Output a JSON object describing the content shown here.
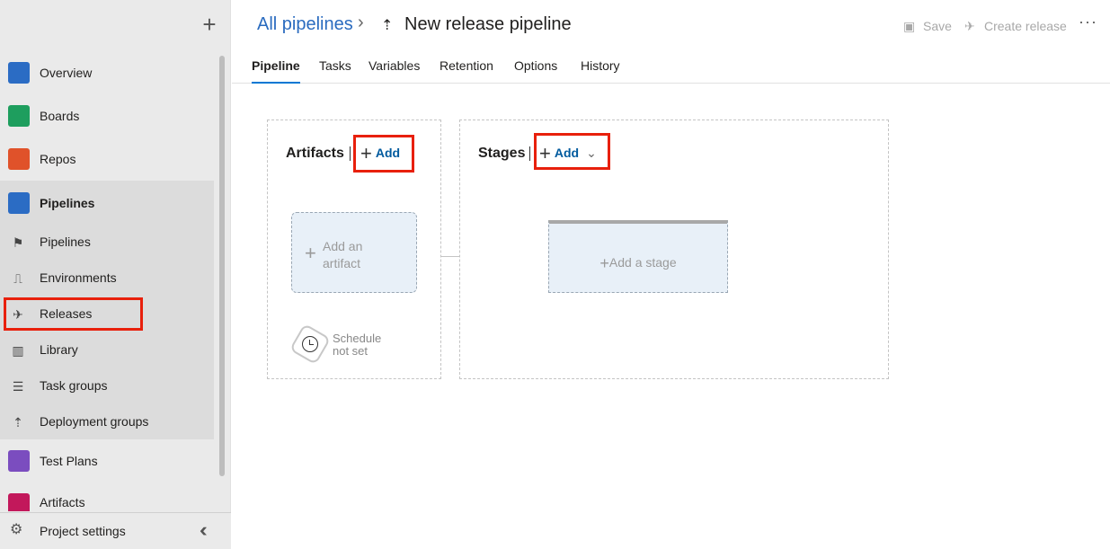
{
  "sidebar": {
    "add_icon": "plus-icon",
    "items": [
      {
        "label": "Overview",
        "icon": "overview-icon",
        "color": "#2b6cc4"
      },
      {
        "label": "Boards",
        "icon": "boards-icon",
        "color": "#1e9e5e"
      },
      {
        "label": "Repos",
        "icon": "repos-icon",
        "color": "#e0522a"
      },
      {
        "label": "Pipelines",
        "icon": "pipelines-icon",
        "color": "#2b6cc4"
      },
      {
        "label": "Test Plans",
        "icon": "test-plans-icon",
        "color": "#7b4dbf"
      },
      {
        "label": "Artifacts",
        "icon": "artifacts-icon",
        "color": "#c2185b"
      }
    ],
    "pipeline_sub_items": [
      {
        "label": "Pipelines",
        "icon": "pipelines-sub-icon"
      },
      {
        "label": "Environments",
        "icon": "environments-icon"
      },
      {
        "label": "Releases",
        "icon": "rocket-icon"
      },
      {
        "label": "Library",
        "icon": "library-icon"
      },
      {
        "label": "Task groups",
        "icon": "task-groups-icon"
      },
      {
        "label": "Deployment groups",
        "icon": "deployment-groups-icon"
      }
    ],
    "settings_label": "Project settings"
  },
  "header": {
    "breadcrumb": "All pipelines",
    "title": "New release pipeline",
    "save_label": "Save",
    "create_release_label": "Create release",
    "more_label": "···",
    "tabs": [
      "Pipeline",
      "Tasks",
      "Variables",
      "Retention",
      "Options",
      "History"
    ],
    "active_tab": "Pipeline"
  },
  "canvas": {
    "artifacts_title": "Artifacts",
    "artifacts_add": "Add",
    "add_artifact_line1": "Add an",
    "add_artifact_line2": "artifact",
    "schedule_line1": "Schedule",
    "schedule_line2": "not set",
    "stages_title": "Stages",
    "stages_add": "Add",
    "add_stage": "Add a stage"
  },
  "colors": {
    "accent": "#0078d4",
    "link": "#2a6bbf",
    "highlight": "#e8200c"
  }
}
